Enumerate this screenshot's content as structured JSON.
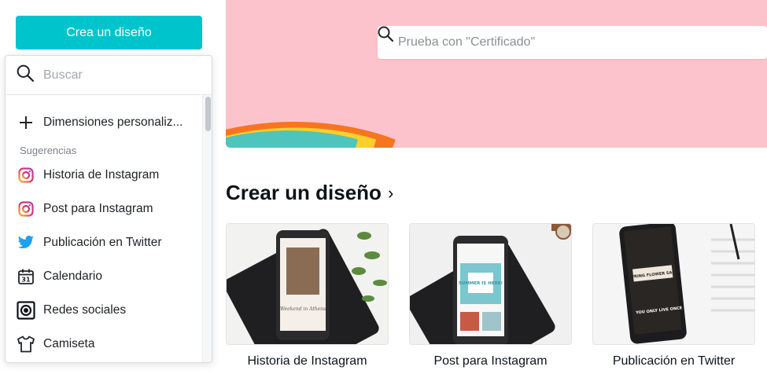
{
  "create_button": {
    "label": "Crea un diseño"
  },
  "hero": {
    "search_placeholder": "Prueba con \"Certificado\"",
    "colors": {
      "background": "#fdc3cc",
      "orange": "#f7751f",
      "yellow": "#fbd02c",
      "teal": "#4ec4bd"
    }
  },
  "dropdown": {
    "search_placeholder": "Buscar",
    "custom_label": "Dimensiones personaliz...",
    "section_label": "Sugerencias",
    "items": [
      {
        "label": "Historia de Instagram",
        "icon": "instagram-icon"
      },
      {
        "label": "Post para Instagram",
        "icon": "instagram-icon"
      },
      {
        "label": "Publicación en Twitter",
        "icon": "twitter-icon"
      },
      {
        "label": "Calendario",
        "icon": "calendar-icon"
      },
      {
        "label": "Redes sociales",
        "icon": "social-media-icon"
      },
      {
        "label": "Camiseta",
        "icon": "tshirt-icon"
      }
    ]
  },
  "main": {
    "heading": "Crear un diseño",
    "heading_chevron": "›",
    "cards": [
      {
        "label": "Historia de Instagram",
        "screen_caption": "Weekend in Athens"
      },
      {
        "label": "Post para Instagram",
        "screen_caption": "SUMMER IS HERE!"
      },
      {
        "label": "Publicación en Twitter",
        "screen_caption": "SPRING FLOWER SALE",
        "screen_caption_2": "YOU ONLY LIVE ONCE"
      }
    ]
  },
  "accent_color": "#00c4cc"
}
